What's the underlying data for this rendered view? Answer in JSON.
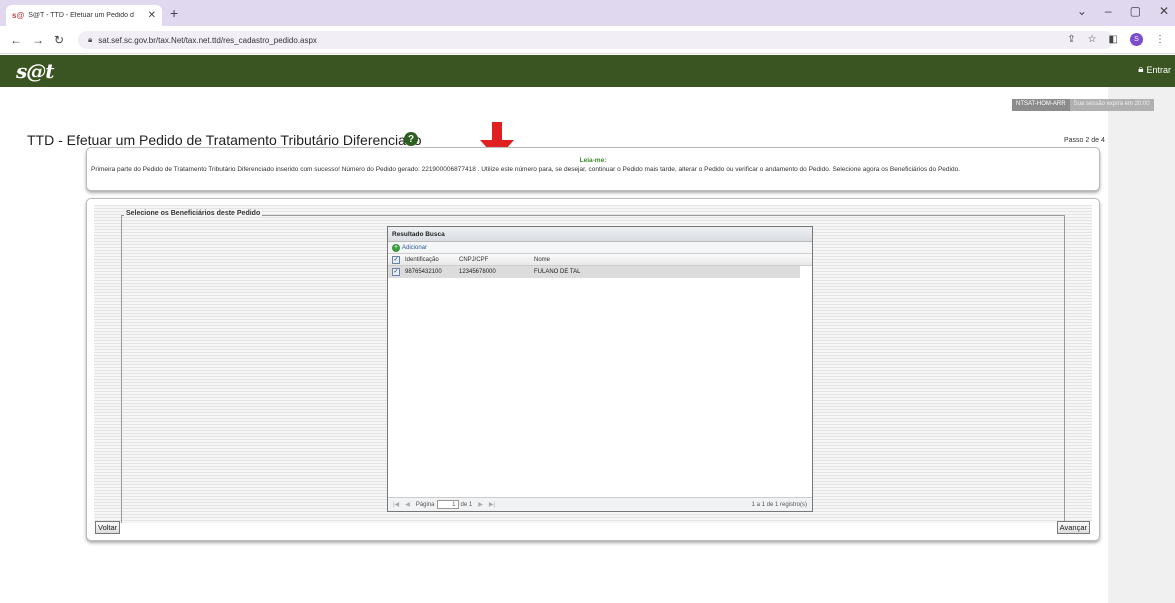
{
  "browser": {
    "tab_title": "S@T - TTD - Efetuar um Pedido d",
    "tab_favicon": "s@t-icon",
    "url": "sat.sef.sc.gov.br/tax.Net/tax.net.ttd/res_cadastro_pedido.aspx",
    "profile_initial": "S",
    "window_controls": [
      "⌄",
      "–",
      "▢",
      "✕"
    ]
  },
  "app": {
    "logo": "s@t",
    "login_label": "Entrar",
    "badge_env": "NTSAT-HOM-ARR",
    "badge_session": "Sua sessão expira em 20:00"
  },
  "page": {
    "title": "TTD - Efetuar um Pedido de Tratamento Tributário Diferenciado",
    "help_icon": "?",
    "step": "Passo 2 de 4"
  },
  "notice": {
    "heading": "Leia-me:",
    "text": "Primeira parte do Pedido de Tratamento Tributário Diferenciado inserido com sucesso! Número do Pedido gerado: 221900006877418 . Utilize este número para, se desejar, continuar o Pedido mais tarde, alterar o Pedido ou verificar o andamento do Pedido. Selecione agora os Beneficiários do Pedido."
  },
  "beneficiaries": {
    "legend": "Selecione os Beneficiários deste Pedido",
    "grid_title": "Resultado Busca",
    "add_label": "Adicionar",
    "columns": {
      "id": "Identificação",
      "cnpj": "CNPJ/CPF",
      "nome": "Nome"
    },
    "rows": [
      {
        "id": "98765432100",
        "cnpj": "12345678000",
        "nome": "FULANO DE TAL",
        "checked": "✓"
      }
    ],
    "pager": {
      "page_label": "Página",
      "page_value": "1",
      "of_label": "de 1",
      "count_label": "1 a 1 de 1 registro(s)"
    }
  },
  "buttons": {
    "back": "Voltar",
    "next": "Avançar"
  },
  "colors": {
    "app_header": "#3a5521",
    "annotation_arrow": "#e02020",
    "leiame_green": "#3a8a2a"
  }
}
